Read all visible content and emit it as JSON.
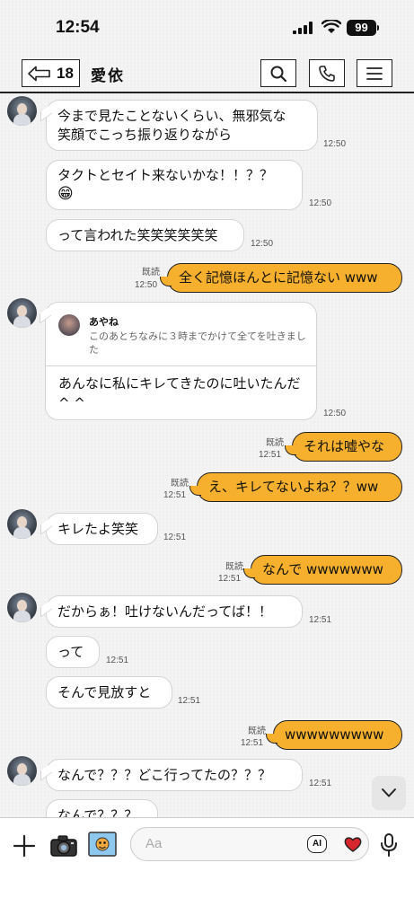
{
  "status": {
    "time": "12:54",
    "battery": "99"
  },
  "header": {
    "back_count": "18",
    "title": "愛依"
  },
  "messages": {
    "m1": {
      "text1": "今まで見たことないくらい、無邪気な",
      "text2": "笑顔でこっち振り返りながら",
      "time": "12:50"
    },
    "m2": {
      "text1": "タクトとセイト来ないかな！！？？",
      "emoji": "😁",
      "time": "12:50"
    },
    "m3": {
      "text": "って言われた笑笑笑笑笑笑",
      "time": "12:50"
    },
    "m4": {
      "text": "全く記憶ほんとに記憶ない www",
      "read": "既読",
      "time": "12:50"
    },
    "m5": {
      "quote_name": "あやね",
      "quote_text": "このあとちなみに３時までかけて全てを吐きました",
      "text": "あんなに私にキレてきたのに吐いたんだ^ ^",
      "time": "12:50"
    },
    "m6": {
      "text": "それは嘘やな",
      "read": "既読",
      "time": "12:51"
    },
    "m7": {
      "text": "え、キレてないよね？？ww",
      "read": "既読",
      "time": "12:51"
    },
    "m8": {
      "text": "キレたよ笑笑",
      "time": "12:51"
    },
    "m9": {
      "text": "なんで wwwwwww",
      "read": "既読",
      "time": "12:51"
    },
    "m10": {
      "text": "だからぁ！吐けないんだってば！！",
      "time": "12:51"
    },
    "m11": {
      "text": "って",
      "time": "12:51"
    },
    "m12": {
      "text": "そんで見放すと",
      "time": "12:51"
    },
    "m13": {
      "text": "wwwwwwwww",
      "read": "既読",
      "time": "12:51"
    },
    "m14": {
      "text": "なんで？？？どこ行ってたの？？？",
      "time": "12:51"
    },
    "m15": {
      "text": "なんで？？？"
    }
  },
  "composer": {
    "placeholder": "Aa",
    "ai_label": "AI"
  },
  "colors": {
    "outgoing_bubble": "#f7b02e",
    "incoming_bubble": "#ffffff",
    "heart": "#d6262e"
  },
  "icons": [
    "back-arrow-icon",
    "search-icon",
    "phone-icon",
    "menu-icon",
    "plus-icon",
    "camera-icon",
    "picture-icon",
    "ai-icon",
    "heart-icon",
    "mic-icon",
    "chevron-down-icon"
  ]
}
